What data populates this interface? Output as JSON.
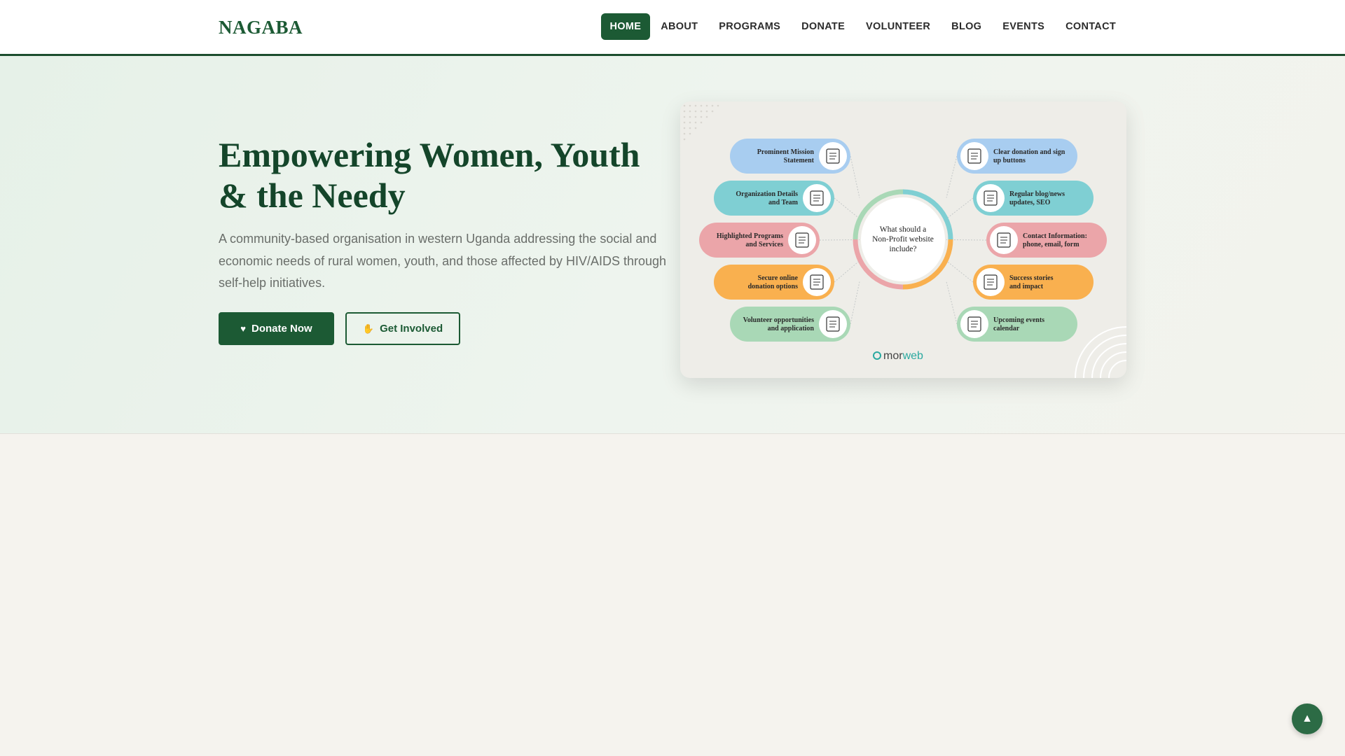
{
  "brand": {
    "logo": "NAGABA"
  },
  "nav": {
    "items": [
      {
        "label": "HOME",
        "active": true
      },
      {
        "label": "ABOUT"
      },
      {
        "label": "PROGRAMS"
      },
      {
        "label": "DONATE"
      },
      {
        "label": "VOLUNTEER"
      },
      {
        "label": "BLOG"
      },
      {
        "label": "EVENTS"
      },
      {
        "label": "CONTACT"
      }
    ]
  },
  "hero": {
    "title": "Empowering Women, Youth & the Needy",
    "description": "A community-based organisation in western Uganda addressing the social and economic needs of rural women, youth, and those affected by HIV/AIDS through self-help initiatives.",
    "primary_button": {
      "label": "Donate Now",
      "icon": "heart-icon"
    },
    "secondary_button": {
      "label": "Get Involved",
      "icon": "hands-icon"
    }
  },
  "infographic": {
    "center_text": [
      "What should a",
      "Non-Profit website",
      "include?"
    ],
    "left_items": [
      {
        "lines": [
          "Prominent Mission",
          "Statement"
        ],
        "color": "#a8cdf0",
        "icon": "document-icon"
      },
      {
        "lines": [
          "Organization Details",
          "and Team"
        ],
        "color": "#7fcfd3",
        "icon": "team-network-icon"
      },
      {
        "lines": [
          "Highlighted Programs",
          "and Services"
        ],
        "color": "#eba5a9",
        "icon": "lightbulb-icon"
      },
      {
        "lines": [
          "Secure online",
          "donation options"
        ],
        "color": "#f9b04f",
        "icon": "card-payment-icon"
      },
      {
        "lines": [
          "Volunteer opportunities",
          "and application"
        ],
        "color": "#a9d8b6",
        "icon": "volunteers-icon"
      }
    ],
    "right_items": [
      {
        "lines": [
          "Clear donation and sign",
          "up buttons"
        ],
        "color": "#a8cdf0",
        "icon": "person-icon"
      },
      {
        "lines": [
          "Regular blog/news",
          "updates, SEO"
        ],
        "color": "#7fcfd3",
        "icon": "chat-icon"
      },
      {
        "lines": [
          "Contact Information:",
          "phone, email, form"
        ],
        "color": "#eba5a9",
        "icon": "contact-form-icon"
      },
      {
        "lines": [
          "Success stories",
          "and impact"
        ],
        "color": "#f9b04f",
        "icon": "success-board-icon"
      },
      {
        "lines": [
          "Upcoming events",
          "calendar"
        ],
        "color": "#a9d8b6",
        "icon": "calendar-icon"
      }
    ],
    "brand_prefix": "mor",
    "brand_suffix": "web"
  },
  "scroll_top": {
    "icon": "arrow-up-icon"
  },
  "colors": {
    "primary": "#1c5a34",
    "title": "#14452a",
    "page_bg": "#f5f3ee"
  }
}
